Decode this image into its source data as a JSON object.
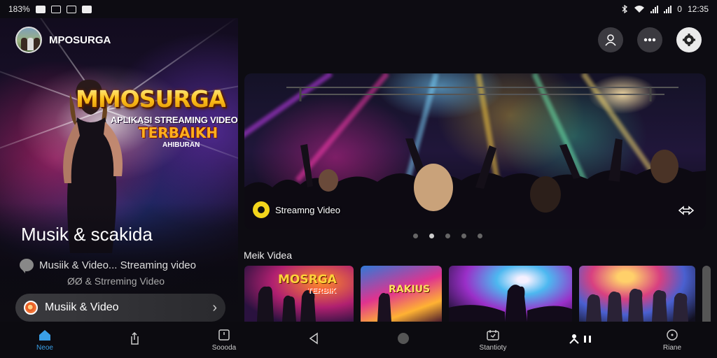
{
  "status_bar": {
    "left_text": "183% ",
    "time": "12:35",
    "right_prefix": "0"
  },
  "header": {
    "app_name": "MPOSURGA"
  },
  "hero_left": {
    "brand_title": "MMOSURGA",
    "brand_subtitle": "APLIKASI STREAMING VIDEO",
    "brand_tagline": "TERBAIKH",
    "brand_small": "AHIBURAN",
    "heading": "Musik & scakida",
    "desc_line1": "Musiik & Video... Streaming video",
    "desc_line2": "ØØ & Strreming Video",
    "pill_label": "Musiik & Video"
  },
  "banner": {
    "label": "Streamng Video",
    "page_count": 5,
    "active_page": 1
  },
  "section": {
    "title": "Meik Videa"
  },
  "thumbnails": [
    {
      "title": "MOSRGA",
      "subtitle": "TERBIK"
    },
    {
      "title": "RAKIUS"
    },
    {
      "title": ""
    },
    {
      "title": ""
    }
  ],
  "bottom_nav": [
    {
      "label": "Neoe",
      "icon": "home-icon",
      "active": true
    },
    {
      "label": "",
      "icon": "share-icon",
      "active": false
    },
    {
      "label": "Soooda",
      "icon": "square-icon",
      "active": false
    },
    {
      "label": "",
      "icon": "back-icon",
      "active": false
    },
    {
      "label": "",
      "icon": "circle-icon",
      "active": false
    },
    {
      "label": "Stantioty",
      "icon": "calendar-icon",
      "active": false
    },
    {
      "label": "",
      "icon": "profile-icon",
      "active": false
    },
    {
      "label": "Riane",
      "icon": "clock-icon",
      "active": false
    }
  ],
  "colors": {
    "accent": "#3aa0e8",
    "brand_gold": "#ffc21a",
    "background": "#0d0c12"
  }
}
